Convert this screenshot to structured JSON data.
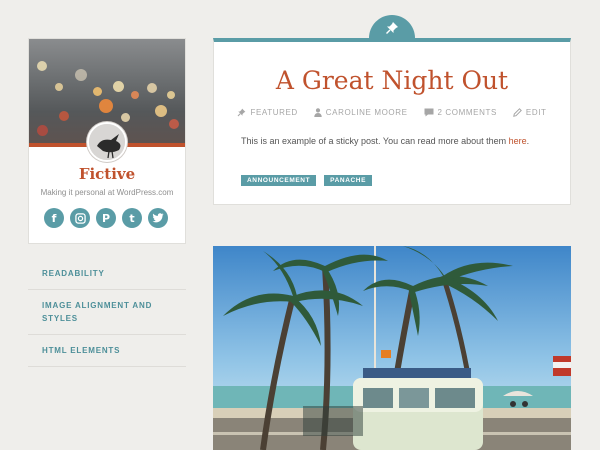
{
  "site": {
    "title": "Fictive",
    "tagline": "Making it personal at WordPress.com"
  },
  "social_links": [
    {
      "icon": "facebook-icon",
      "glyph": "f"
    },
    {
      "icon": "instagram-icon",
      "glyph": ""
    },
    {
      "icon": "pinterest-icon",
      "glyph": "P"
    },
    {
      "icon": "tumblr-icon",
      "glyph": "t"
    },
    {
      "icon": "twitter-icon",
      "glyph": ""
    }
  ],
  "sidebar_nav": [
    {
      "label": "Readability"
    },
    {
      "label": "Image Alignment and Styles"
    },
    {
      "label": "HTML Elements"
    }
  ],
  "post": {
    "title": "A Great Night Out",
    "meta": {
      "featured": "Featured",
      "author": "Caroline Moore",
      "comments": "2 Comments",
      "edit": "Edit"
    },
    "excerpt_text": "This is an example of a sticky post. You can read more about them ",
    "excerpt_link": "here",
    "excerpt_end": ".",
    "tags": [
      "Announcement",
      "Panache"
    ]
  },
  "colors": {
    "accent": "#c0522d",
    "teal": "#5a9ca6",
    "background": "#efeeeb"
  }
}
